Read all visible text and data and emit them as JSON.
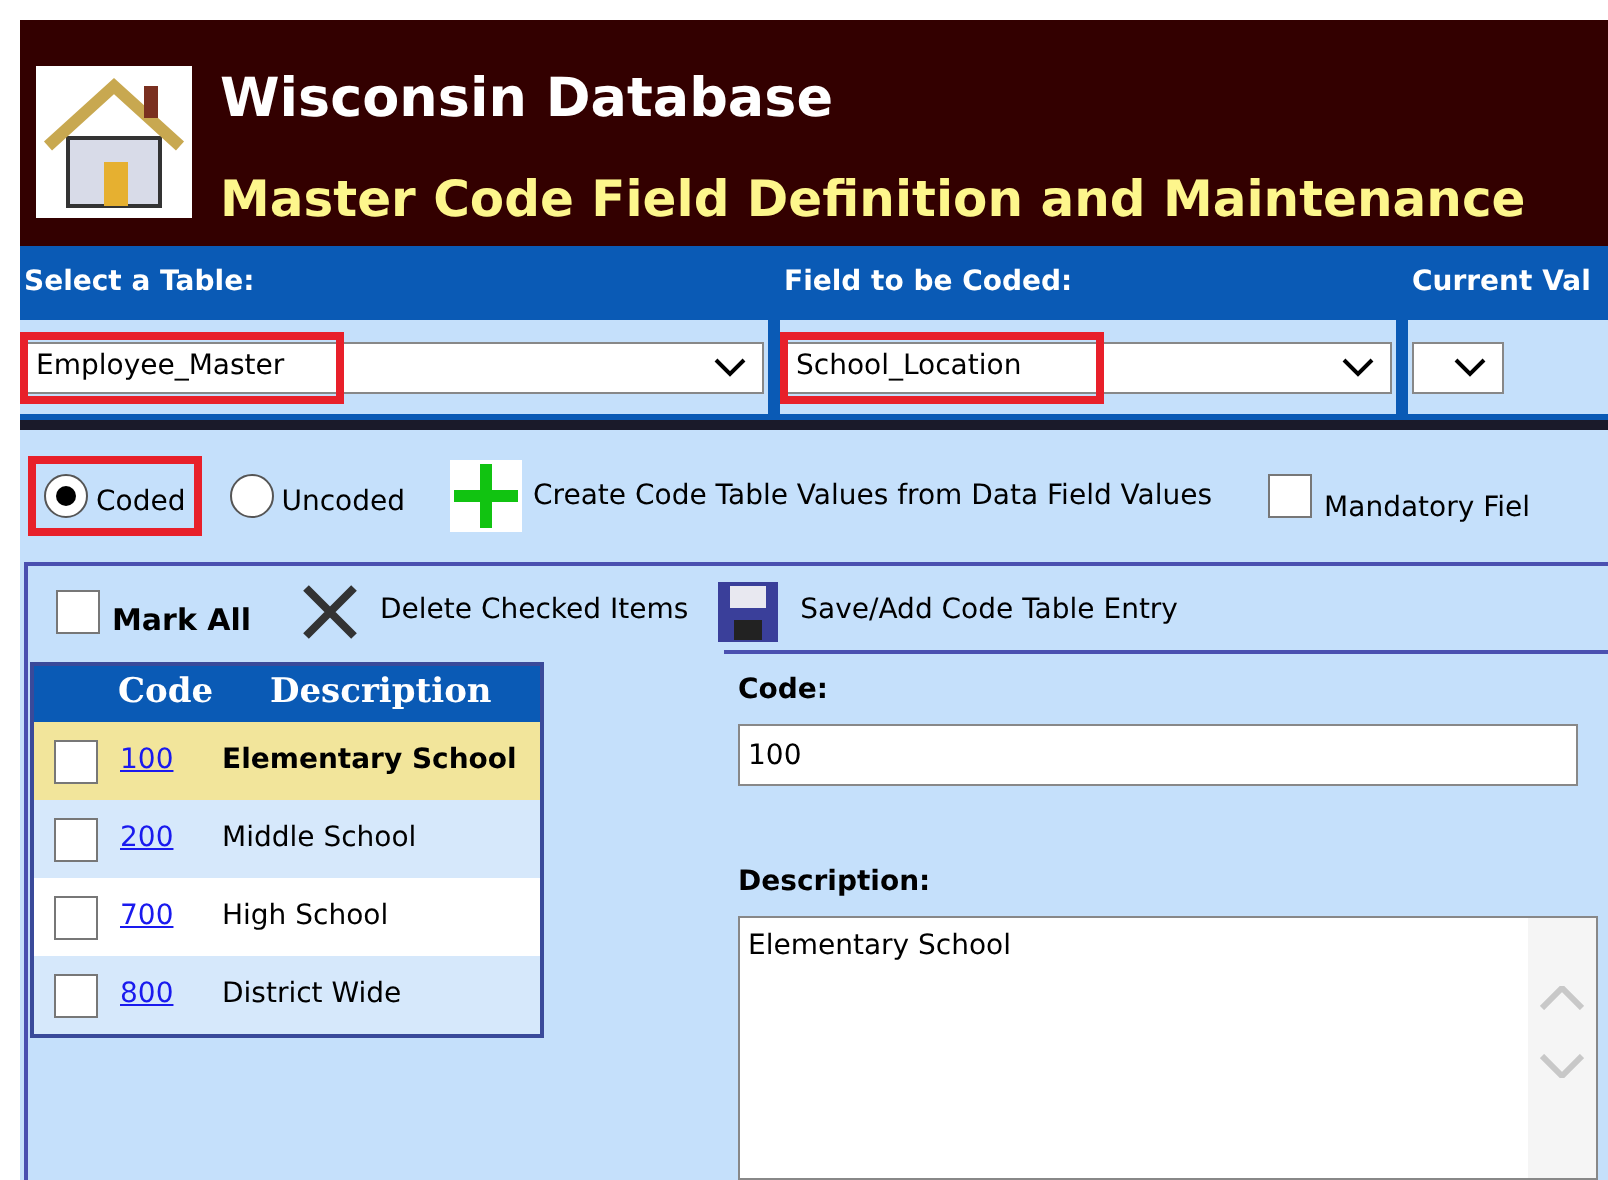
{
  "header": {
    "title": "Wisconsin Database",
    "subtitle": "Master Code Field Definition and Maintenance"
  },
  "selectors": [
    {
      "label": "Select a Table:",
      "value": "Employee_Master",
      "highlighted": true
    },
    {
      "label": "Field to be Coded:",
      "value": "School_Location",
      "highlighted": true
    },
    {
      "label": "Current Val"
    }
  ],
  "mode_options": [
    {
      "label": "Coded",
      "selected": true,
      "highlighted": true
    },
    {
      "label": "Uncoded",
      "selected": false
    }
  ],
  "create_button": "Create Code Table Values from Data Field Values",
  "mandatory": {
    "label": "Mandatory Fiel",
    "checked": false
  },
  "toolbar": {
    "mark_all": {
      "label": "Mark All",
      "checked": false
    },
    "delete": "Delete Checked Items",
    "save": "Save/Add Code Table Entry"
  },
  "grid": {
    "columns": [
      "Code",
      "Description"
    ],
    "rows": [
      {
        "code": "100",
        "description": "Elementary School",
        "checked": false,
        "selected": true
      },
      {
        "code": "200",
        "description": "Middle School",
        "checked": false,
        "selected": false
      },
      {
        "code": "700",
        "description": "High School",
        "checked": false,
        "selected": false
      },
      {
        "code": "800",
        "description": "District Wide",
        "checked": false,
        "selected": false
      }
    ]
  },
  "form": {
    "code_label": "Code:",
    "code_value": "100",
    "description_label": "Description:",
    "description_value": "Elementary School"
  }
}
